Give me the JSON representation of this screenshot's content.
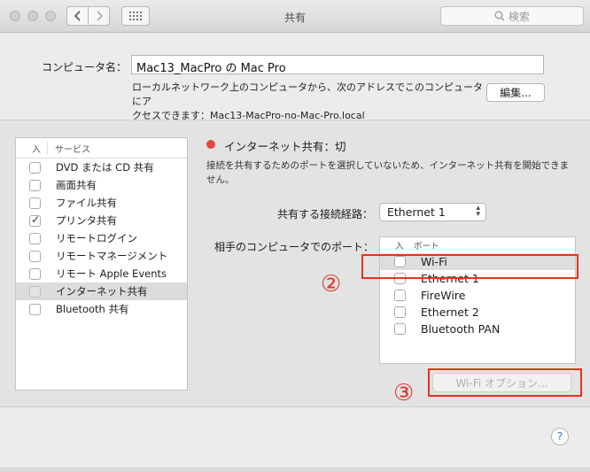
{
  "window": {
    "title": "共有",
    "search_placeholder": "検索"
  },
  "computer_name": {
    "label": "コンピュータ名：",
    "value": "Mac13_MacPro の Mac Pro",
    "description_line1": "ローカルネットワーク上のコンピュータから、次のアドレスでこのコンピュータにア",
    "description_line2": "クセスできます：Mac13-MacPro-no-Mac-Pro.local",
    "edit_button": "編集..."
  },
  "services": {
    "header_on": "入",
    "header_service": "サービス",
    "items": [
      {
        "label": "DVD または CD 共有",
        "checked": false
      },
      {
        "label": "画面共有",
        "checked": false
      },
      {
        "label": "ファイル共有",
        "checked": false
      },
      {
        "label": "プリンタ共有",
        "checked": true
      },
      {
        "label": "リモートログイン",
        "checked": false
      },
      {
        "label": "リモートマネージメント",
        "checked": false
      },
      {
        "label": "リモート Apple Events",
        "checked": false
      },
      {
        "label": "インターネット共有",
        "checked": false
      },
      {
        "label": "Bluetooth 共有",
        "checked": false
      }
    ]
  },
  "internet_sharing": {
    "status_text": "インターネット共有：切",
    "status_color": "#e8453c",
    "description": "接続を共有するためのポートを選択していないため、インターネット共有を開始できません。",
    "connection_label": "共有する接続経路：",
    "connection_value": "Ethernet 1",
    "ports_label": "相手のコンピュータでのポート：",
    "ports_header_on": "入",
    "ports_header_port": "ポート",
    "ports": [
      {
        "label": "Wi-Fi",
        "checked": false
      },
      {
        "label": "Ethernet 1",
        "checked": false
      },
      {
        "label": "FireWire",
        "checked": false
      },
      {
        "label": "Ethernet 2",
        "checked": false
      },
      {
        "label": "Bluetooth PAN",
        "checked": false
      }
    ],
    "wifi_options_button": "Wi-Fi オプション..."
  },
  "annotations": {
    "marker2": "②",
    "marker3": "③",
    "color": "#e5331f"
  },
  "help": {
    "label": "?"
  }
}
